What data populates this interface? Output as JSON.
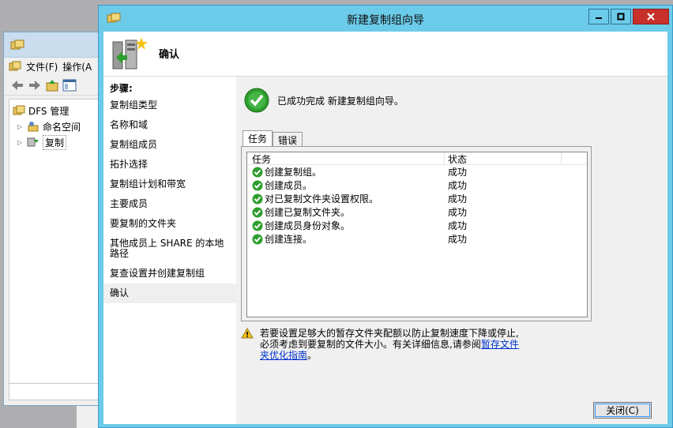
{
  "background_window": {
    "menu": {
      "file": "文件(F)",
      "action": "操作(A"
    },
    "tree": [
      {
        "label": "DFS 管理"
      },
      {
        "label": "命名空间"
      },
      {
        "label": "复制"
      }
    ]
  },
  "dialog": {
    "title": "新建复制组向导",
    "header_title": "确认",
    "steps_title": "步骤:",
    "steps": [
      "复制组类型",
      "名称和域",
      "复制组成员",
      "拓扑选择",
      "复制组计划和带宽",
      "主要成员",
      "要复制的文件夹",
      "其他成员上 SHARE 的本地路径",
      "复查设置并创建复制组",
      "确认"
    ],
    "success_message": "已成功完成 新建复制组向导。",
    "tabs": [
      "任务",
      "错误"
    ],
    "columns": [
      "任务",
      "状态"
    ],
    "tasks": [
      {
        "task": "创建复制组。",
        "status": "成功"
      },
      {
        "task": "创建成员。",
        "status": "成功"
      },
      {
        "task": "对已复制文件夹设置权限。",
        "status": "成功"
      },
      {
        "task": "创建已复制文件夹。",
        "status": "成功"
      },
      {
        "task": "创建成员身份对象。",
        "status": "成功"
      },
      {
        "task": "创建连接。",
        "status": "成功"
      }
    ],
    "warning_line1": "若要设置足够大的暂存文件夹配额以防止复制速度下降或停止,",
    "warning_line2": "必须考虑到要复制的文件大小。有关详细信息,请参阅",
    "warning_link_a": "暂存文件",
    "warning_link_b": "夹优化指南",
    "warning_end": "。",
    "close_button": "关闭(C)",
    "colors": {
      "titlebar": "#6bcbe9",
      "close": "#c7312a",
      "success": "#2e9e2e"
    }
  }
}
